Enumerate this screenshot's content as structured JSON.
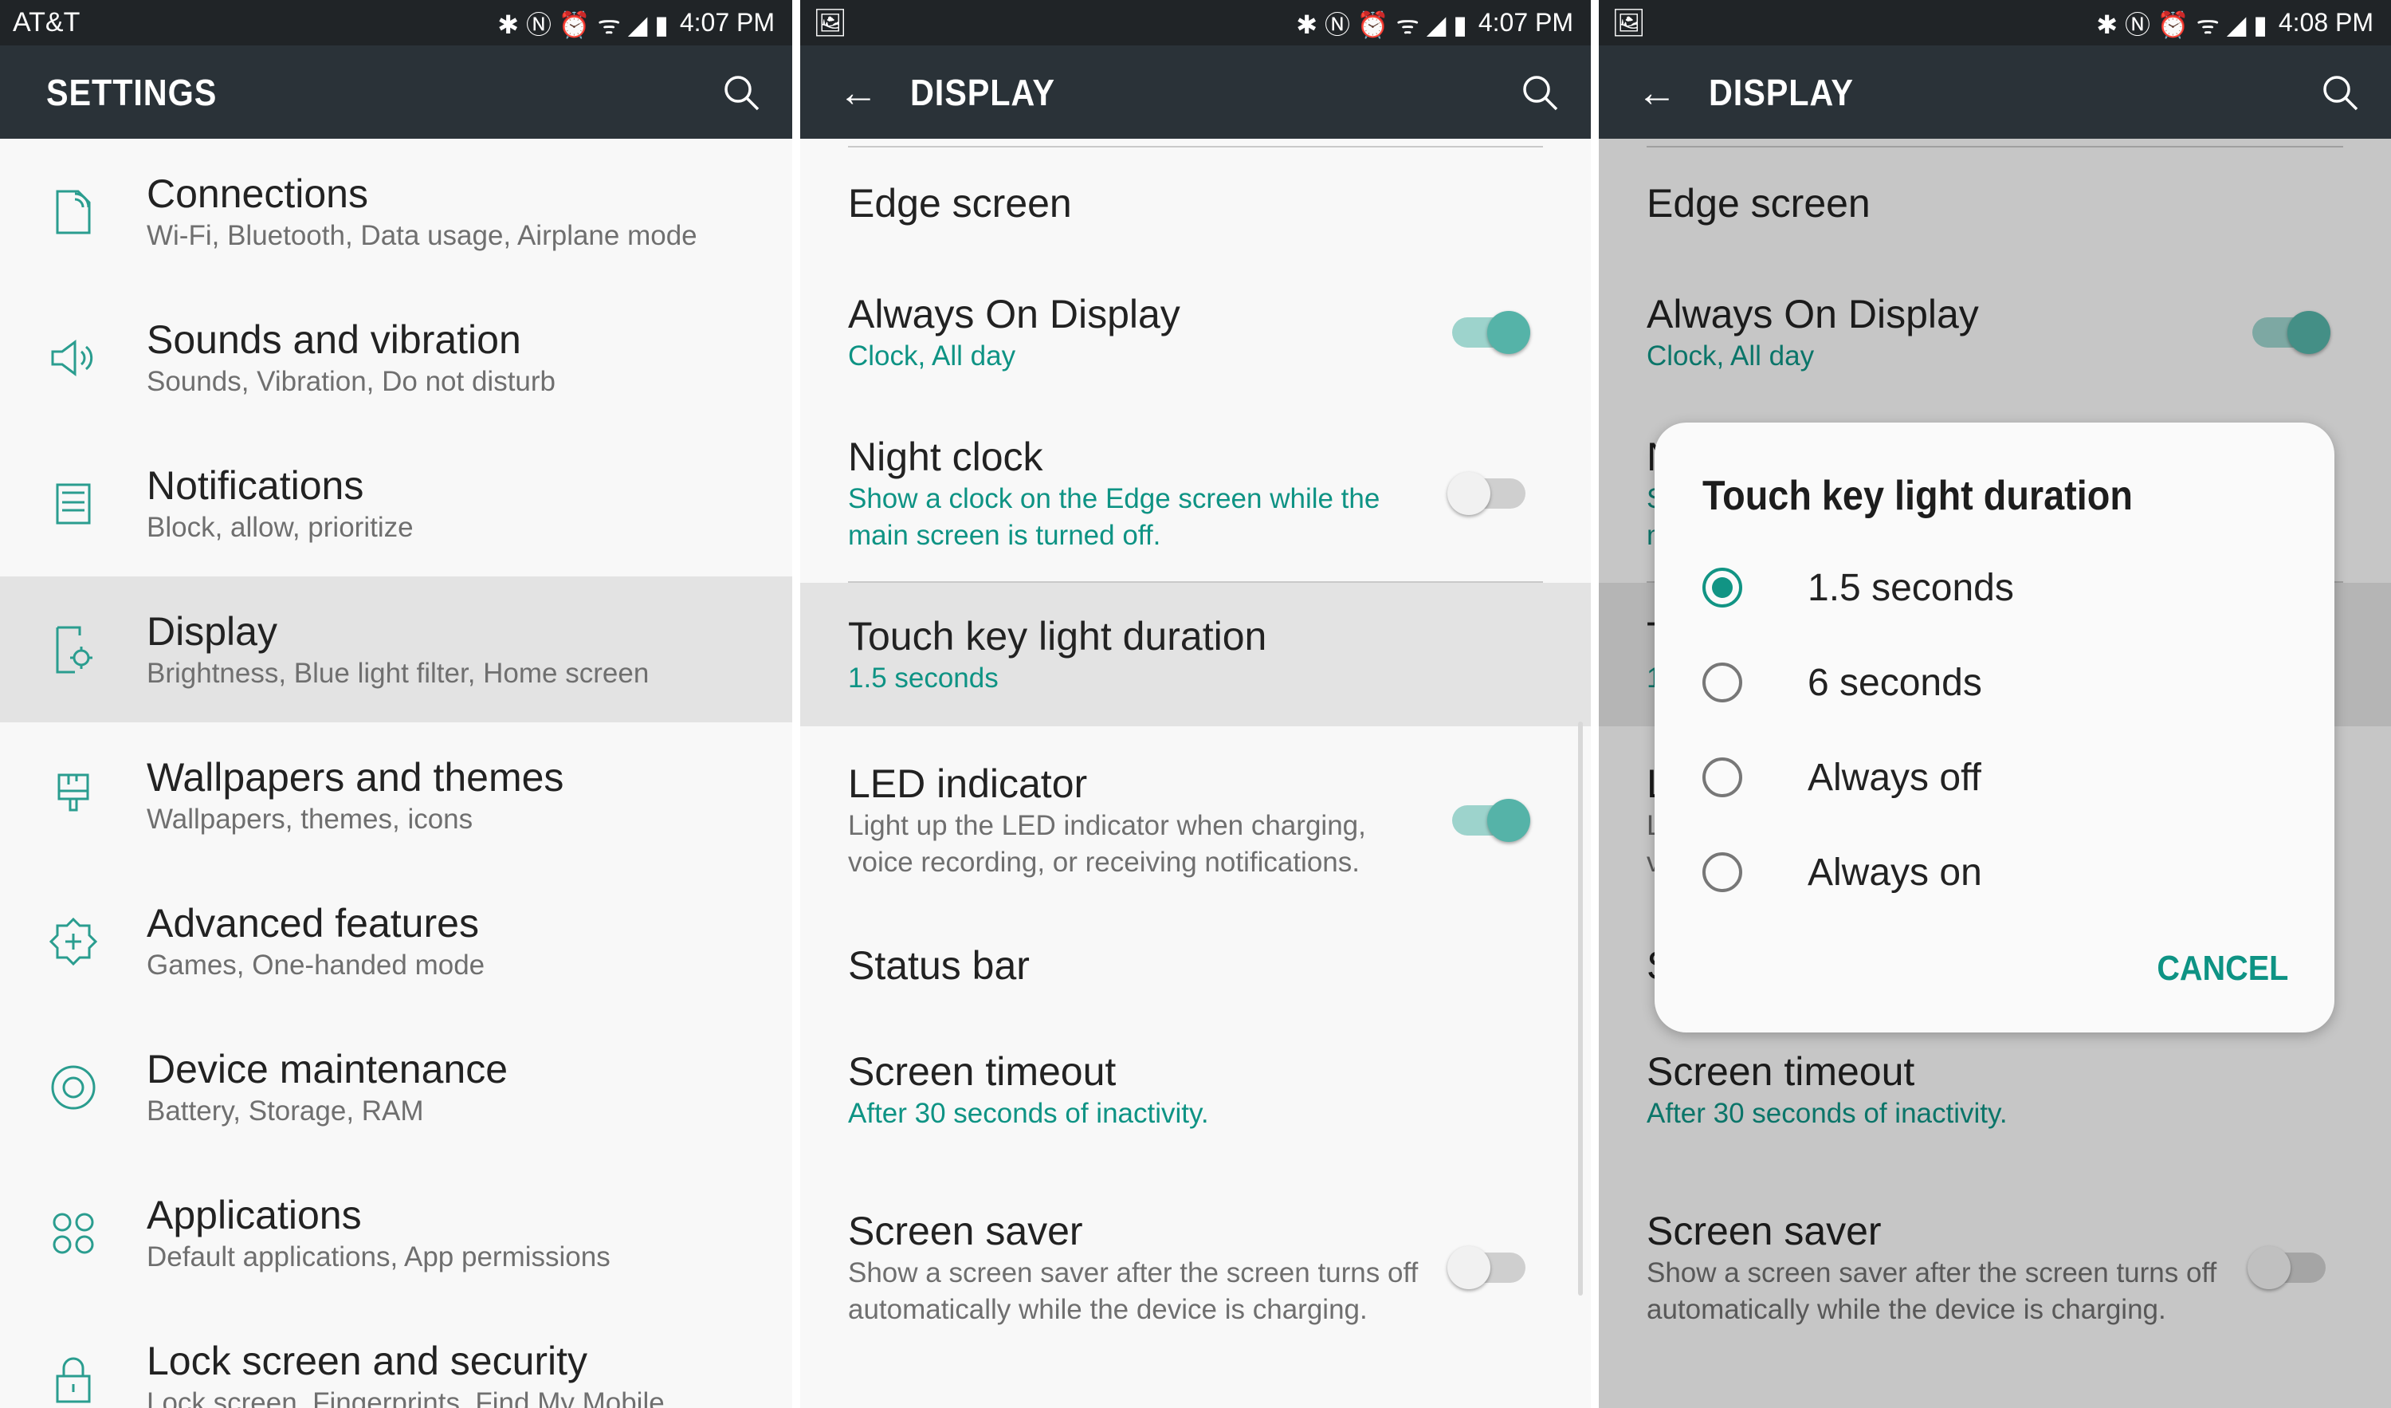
{
  "accent": "#0e9384",
  "panel1": {
    "status": {
      "carrier": "AT&T",
      "time": "4:07 PM"
    },
    "title": "SETTINGS",
    "items": [
      {
        "title": "Connections",
        "sub": "Wi-Fi, Bluetooth, Data usage, Airplane mode",
        "icon": "connections-icon"
      },
      {
        "title": "Sounds and vibration",
        "sub": "Sounds, Vibration, Do not disturb",
        "icon": "speaker-icon"
      },
      {
        "title": "Notifications",
        "sub": "Block, allow, prioritize",
        "icon": "notifications-icon"
      },
      {
        "title": "Display",
        "sub": "Brightness, Blue light filter, Home screen",
        "icon": "display-icon",
        "selected": true
      },
      {
        "title": "Wallpapers and themes",
        "sub": "Wallpapers, themes, icons",
        "icon": "paintbrush-icon"
      },
      {
        "title": "Advanced features",
        "sub": "Games, One-handed mode",
        "icon": "gear-plus-icon"
      },
      {
        "title": "Device maintenance",
        "sub": "Battery, Storage, RAM",
        "icon": "maintenance-icon"
      },
      {
        "title": "Applications",
        "sub": "Default applications, App permissions",
        "icon": "apps-icon"
      },
      {
        "title": "Lock screen and security",
        "sub": "Lock screen, Fingerprints, Find My Mobile",
        "icon": "lock-icon"
      }
    ]
  },
  "panel2": {
    "status": {
      "time": "4:07 PM"
    },
    "title": "DISPLAY"
  },
  "panel3": {
    "status": {
      "time": "4:08 PM"
    },
    "title": "DISPLAY"
  },
  "display_items": [
    {
      "title": "Edge screen"
    },
    {
      "title": "Always On Display",
      "sub": "Clock, All day",
      "teal": true,
      "toggle": "on"
    },
    {
      "title": "Night clock",
      "sub": "Show a clock on the Edge screen while the main screen is turned off.",
      "teal": true,
      "toggle": "off",
      "divider": true
    },
    {
      "title": "Touch key light duration",
      "sub": "1.5 seconds",
      "teal": true,
      "selected": true
    },
    {
      "title": "LED indicator",
      "sub": "Light up the LED indicator when charging, voice recording, or receiving notifications.",
      "toggle": "on"
    },
    {
      "title": "Status bar"
    },
    {
      "title": "Screen timeout",
      "sub": "After 30 seconds of inactivity.",
      "teal": true
    },
    {
      "title": "Screen saver",
      "sub": "Show a screen saver after the screen turns off automatically while the device is charging.",
      "toggle": "off"
    }
  ],
  "dialog": {
    "title": "Touch key light duration",
    "options": [
      "1.5 seconds",
      "6 seconds",
      "Always off",
      "Always on"
    ],
    "selected": "1.5 seconds",
    "cancel": "CANCEL"
  }
}
